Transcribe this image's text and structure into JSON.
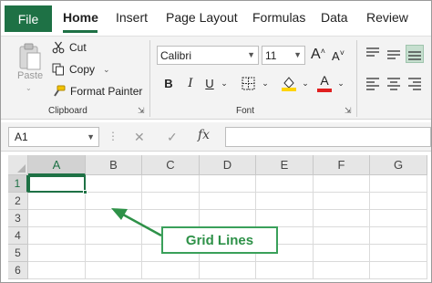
{
  "tabs": [
    {
      "label": "File"
    },
    {
      "label": "Home"
    },
    {
      "label": "Insert"
    },
    {
      "label": "Page Layout"
    },
    {
      "label": "Formulas"
    },
    {
      "label": "Data"
    },
    {
      "label": "Review"
    }
  ],
  "clipboard": {
    "paste_label": "Paste",
    "cut_label": "Cut",
    "copy_label": "Copy",
    "format_painter_label": "Format Painter",
    "group_label": "Clipboard"
  },
  "font": {
    "font_name": "Calibri",
    "font_size": "11",
    "grow_label": "A",
    "shrink_label": "A",
    "bold_label": "B",
    "italic_label": "I",
    "underline_label": "U",
    "font_color_label": "A",
    "group_label": "Font"
  },
  "formula_bar": {
    "name_box": "A1",
    "fx_label": "fx",
    "formula": ""
  },
  "grid": {
    "columns": [
      "A",
      "B",
      "C",
      "D",
      "E",
      "F",
      "G"
    ],
    "rows": [
      "1",
      "2",
      "3",
      "4",
      "5",
      "6"
    ],
    "active_cell": "A1"
  },
  "annotation": {
    "label": "Grid Lines"
  },
  "colors": {
    "accent": "#1e7145",
    "callout": "#2e9148",
    "fill_color": "#ffd400",
    "font_color": "#e02020"
  }
}
